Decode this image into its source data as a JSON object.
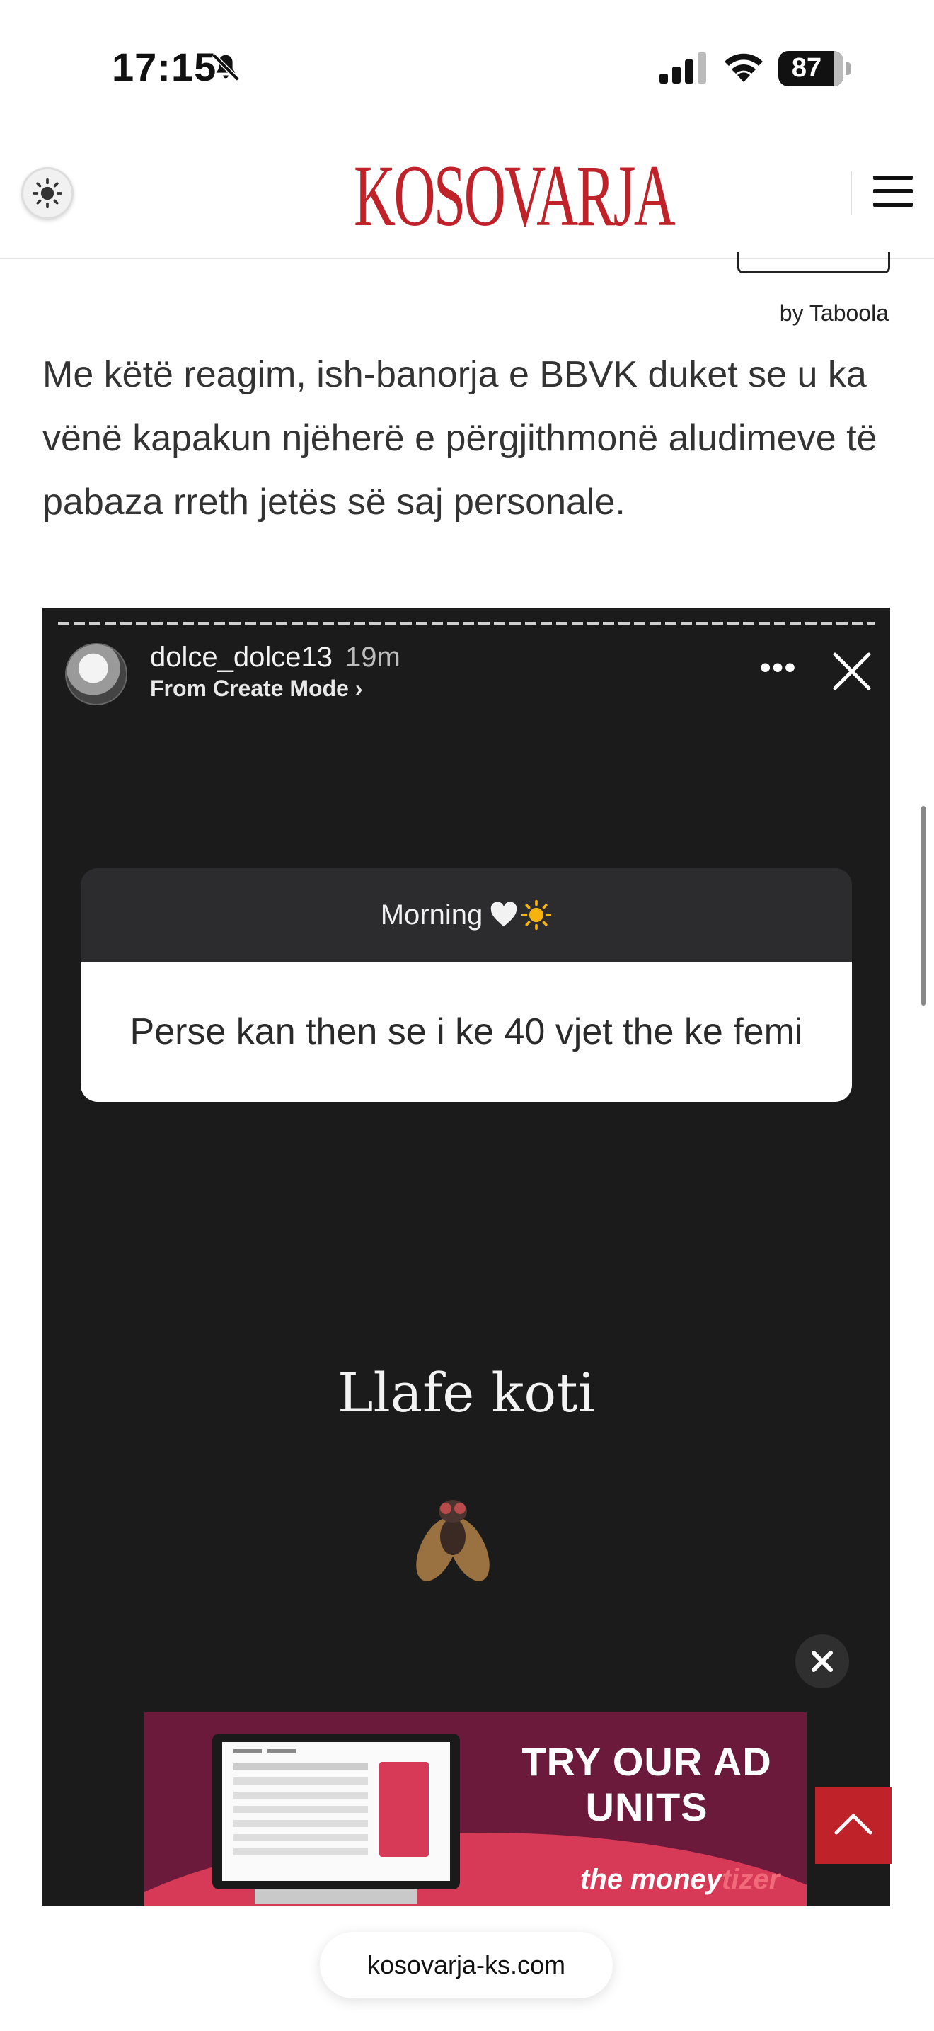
{
  "status_bar": {
    "time": "17:15",
    "battery": "87",
    "icons": [
      "bell-slash-icon",
      "signal-icon",
      "wifi-icon",
      "battery-icon"
    ]
  },
  "header": {
    "logo": "KOSOVARJA",
    "theme_icon": "sun-icon",
    "menu_icon": "hamburger-icon",
    "brand_color": "#c0222a"
  },
  "article": {
    "by_taboola": "by Taboola",
    "paragraph": "Me këtë reagim, ish-banorja e BBVK duket se u ka vënë kapakun njëherë e përgjithmonë aludimeve të pabaza rreth jetës së saj personale."
  },
  "story": {
    "username": "dolce_dolce13",
    "time": "19m",
    "subtitle": "From Create Mode ›",
    "question_header": "Morning",
    "question_text": "Perse kan then se i ke 40 vjet the ke femi",
    "caption": "Llafe koti",
    "more_icon": "ellipsis-icon",
    "close_icon": "close-icon",
    "emoji_icon": "fly-icon"
  },
  "ad": {
    "title": "TRY OUR AD UNITS",
    "brand_prefix": "the",
    "brand_main": "money",
    "brand_suffix": "tizer",
    "close_icon": "close-icon"
  },
  "scroll_top_icon": "chevron-up-icon",
  "url": "kosovarja-ks.com"
}
